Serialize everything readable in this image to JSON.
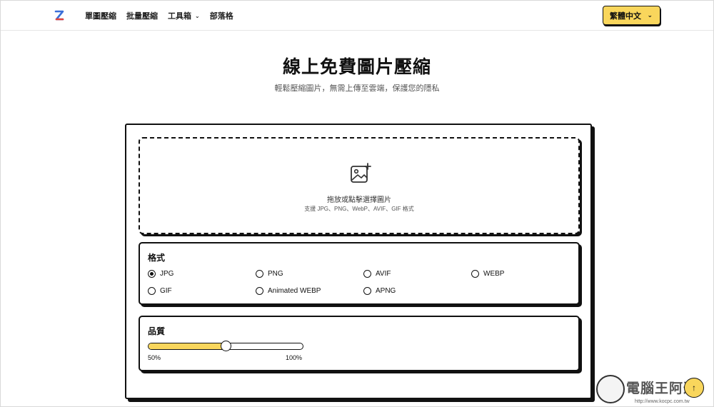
{
  "header": {
    "nav": [
      {
        "label": "單圖壓縮"
      },
      {
        "label": "批量壓縮"
      },
      {
        "label": "工具箱",
        "has_dropdown": true
      },
      {
        "label": "部落格"
      }
    ],
    "language_button": "繁體中文"
  },
  "hero": {
    "title": "線上免費圖片壓縮",
    "subtitle": "輕鬆壓縮圖片，無需上傳至雲端，保護您的隱私"
  },
  "dropzone": {
    "main_text": "拖放或點擊選擇圖片",
    "sub_text": "支援 JPG、PNG、WebP、AVIF、GIF 格式"
  },
  "format": {
    "title": "格式",
    "selected": "JPG",
    "options": [
      "JPG",
      "PNG",
      "AVIF",
      "WEBP",
      "GIF",
      "Animated WEBP",
      "APNG"
    ]
  },
  "quality": {
    "title": "品質",
    "value": 50,
    "min_label": "50%",
    "max_label": "100%"
  },
  "watermark": {
    "text": "電腦王阿達",
    "url": "http://www.kocpc.com.tw"
  },
  "colors": {
    "accent": "#f9d65c",
    "border": "#111111"
  }
}
